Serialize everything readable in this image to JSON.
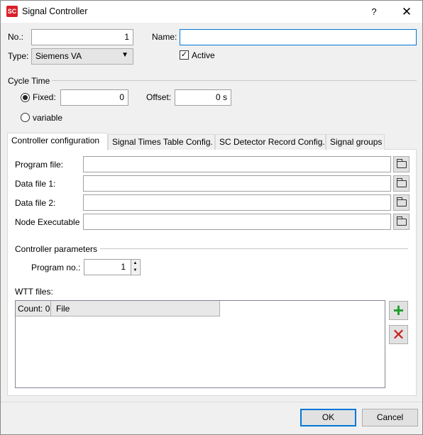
{
  "window": {
    "title": "Signal Controller",
    "help_glyph": "?",
    "close_glyph": "✕",
    "icon_text": "SC"
  },
  "header": {
    "no_label": "No.:",
    "no_value": "1",
    "name_label": "Name:",
    "name_value": "",
    "type_label": "Type:",
    "type_value": "Siemens VA",
    "active_label": "Active",
    "active_checked": true
  },
  "cycle_time": {
    "section_label": "Cycle Time",
    "fixed_label": "Fixed:",
    "fixed_value": "0",
    "fixed_selected": true,
    "offset_label": "Offset:",
    "offset_value": "0 s",
    "variable_label": "variable"
  },
  "tabs": [
    {
      "label": "Controller configuration",
      "active": true
    },
    {
      "label": "Signal Times Table Config."
    },
    {
      "label": "SC Detector Record Config."
    },
    {
      "label": "Signal groups"
    }
  ],
  "controller_config": {
    "program_file_label": "Program file:",
    "program_file_value": "",
    "data_file1_label": "Data file 1:",
    "data_file1_value": "",
    "data_file2_label": "Data file 2:",
    "data_file2_value": "",
    "node_exec_label": "Node Executable",
    "node_exec_value": "",
    "params_label": "Controller parameters",
    "program_no_label": "Program no.:",
    "program_no_value": "1",
    "wtt_label": "WTT files:",
    "grid_count": "Count: 0",
    "grid_file_col": "File"
  },
  "footer": {
    "ok_label": "OK",
    "cancel_label": "Cancel"
  },
  "icons": {
    "add": "plus-icon",
    "remove": "x-icon",
    "browse": "folder-icon",
    "add_color": "#1e9e2a",
    "remove_color": "#c81e1e",
    "accent": "#0078d7"
  }
}
